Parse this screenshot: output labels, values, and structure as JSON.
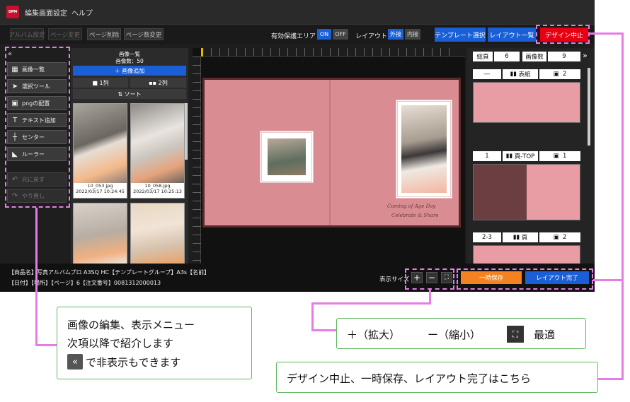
{
  "titlebar": {
    "logo": "DPM",
    "menu": [
      "編集画面設定",
      "ヘルプ"
    ]
  },
  "toolbar": {
    "album_settings": "アルバム設定",
    "page_change": "ページ変更",
    "page_delete": "ページ削除",
    "page_count_change": "ページ数変更",
    "protect_area_label": "有効保護エリア",
    "on": "ON",
    "off": "OFF",
    "layout_label": "レイアウト",
    "outer": "外接",
    "inner": "内接",
    "template_select": "テンプレート選択",
    "layout_list": "レイアウト一覧",
    "design_cancel": "デザイン中止"
  },
  "left_panel": {
    "collapse": "«",
    "items": [
      "画像一覧",
      "選択ツール",
      "pngの配置",
      "テキスト追加",
      "センター",
      "ルーラー"
    ],
    "undo": "元に戻す",
    "redo": "やり直し"
  },
  "image_panel": {
    "title": "画像一覧",
    "count_label": "画像数：50",
    "add": "＋ 画像追加",
    "one_col": "1列",
    "two_col": "2列",
    "sort": "ソート",
    "thumbs": [
      {
        "name": "10_053.jpg",
        "date": "2022/03/17 10:24:45"
      },
      {
        "name": "10_058.jpg",
        "date": "2022/03/17 10:25:13"
      }
    ]
  },
  "right_panel": {
    "pages_label": "総頁",
    "pages": "6",
    "images_label": "画像数",
    "images": "9",
    "expand": "»",
    "groups": [
      {
        "num": "---",
        "type": "表紙",
        "count": "2"
      },
      {
        "num": "1",
        "type": "頁-TOP",
        "count": "1"
      },
      {
        "num": "2-3",
        "type": "頁",
        "count": "2"
      }
    ]
  },
  "status": {
    "line1": "【商品名】写真アルバムプロ A3SQ HC【テンプレートグループ】A3s【名前】",
    "line2": "【日付】【場所】【ページ】6【注文番号】0081312000013",
    "zoom_label": "表示サイズ",
    "plus": "+",
    "minus": "−",
    "save_temp": "一時保存",
    "layout_done": "レイアウト完了"
  },
  "spread": {
    "script1": "Coming of Age Day",
    "script2": "Celebrate & Share"
  },
  "callouts": {
    "left": [
      "画像の編集、表示メニュー",
      "次項以降で紹介します",
      "で非表示もできます"
    ],
    "left_icon": "«",
    "zoom_plus": "＋（拡大）",
    "zoom_minus": "ー（縮小）",
    "zoom_fit": "最適",
    "right": "デザイン中止、一時保存、レイアウト完了はこちら"
  },
  "colors": {
    "accent_blue": "#1a5fd6",
    "red": "#e60012",
    "orange": "#f58220",
    "highlight": "#e67ce6",
    "callout_border": "#5cb85c"
  }
}
